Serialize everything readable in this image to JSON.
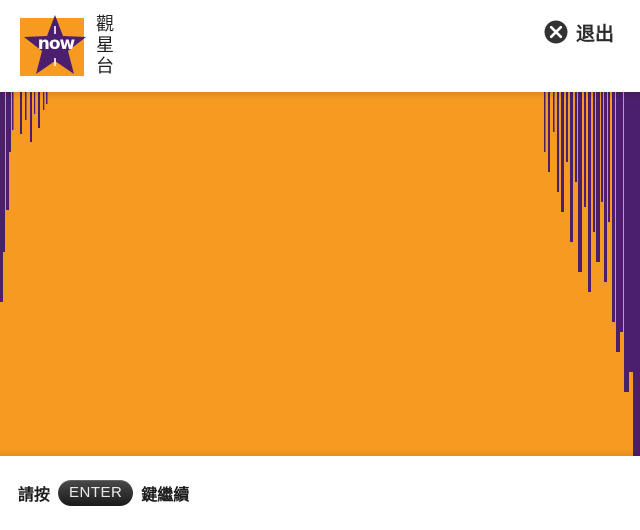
{
  "header": {
    "logo": {
      "brand_text": "now",
      "chinese_chars": [
        "觀",
        "星",
        "台"
      ]
    },
    "exit": {
      "label": "退出",
      "icon": "close-circle-icon"
    }
  },
  "panel": {
    "background_color": "#f79a22",
    "accent_color": "#4b1f6e"
  },
  "footer": {
    "prefix": "請按",
    "key_label": "ENTER",
    "suffix": "鍵繼續"
  }
}
